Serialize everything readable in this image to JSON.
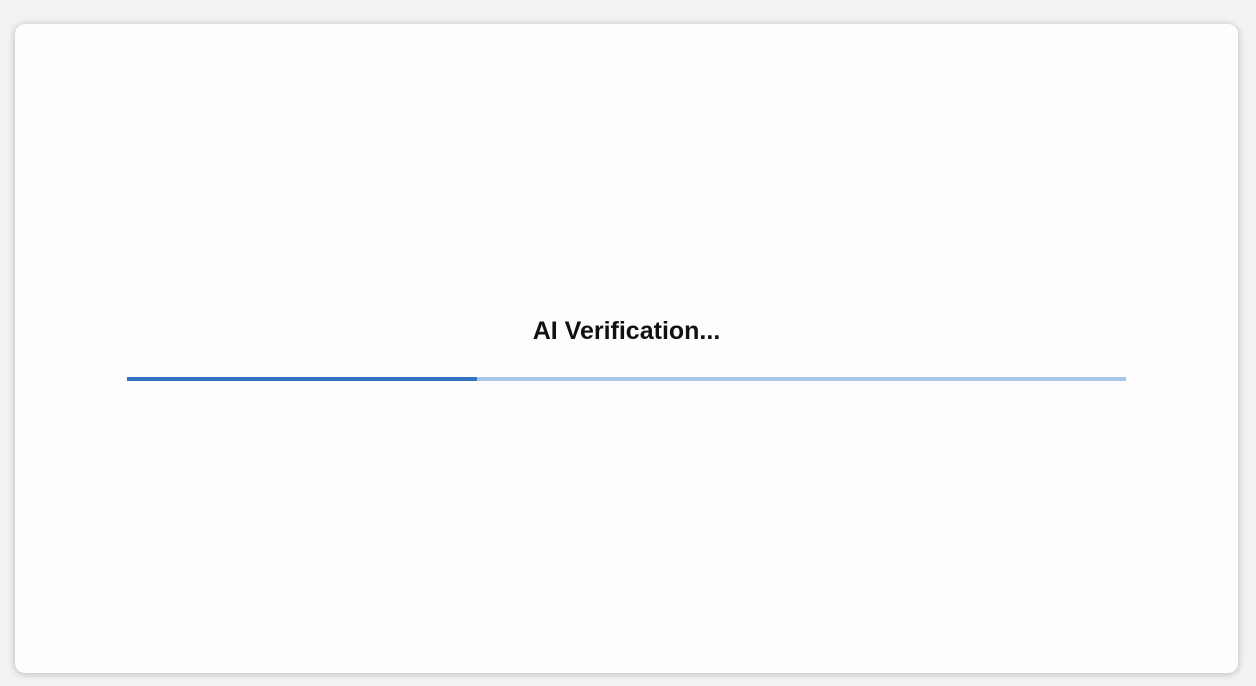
{
  "dialog": {
    "title": "AI Verification...",
    "progress_percent": 35,
    "colors": {
      "progress_fill": "#2f73c1",
      "progress_track": "#aac6e6"
    }
  }
}
